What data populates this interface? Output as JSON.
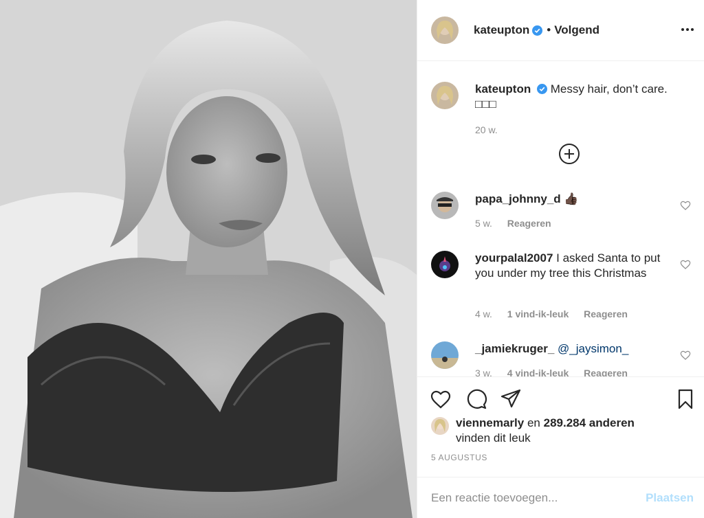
{
  "post": {
    "image_alt": "Black and white portrait photo",
    "author": {
      "username": "kateupton",
      "verified": true,
      "follow_status": "Volgend",
      "separator": "•"
    },
    "caption": {
      "username": "kateupton",
      "text": "Messy hair, don’t care.",
      "emoji_line": "□□□",
      "time": "20 w."
    },
    "comments": [
      {
        "username": "papa_johnny_d",
        "text": "👍🏿",
        "time": "5 w.",
        "likes": "",
        "reply": "Reageren"
      },
      {
        "username": "yourpalal2007",
        "text": "I asked Santa to put you under my tree this Christmas",
        "time": "4 w.",
        "likes": "1 vind-ik-leuk",
        "reply": "Reageren"
      },
      {
        "username": "_jamiekruger_",
        "text": "@_jaysimon_",
        "time": "3 w.",
        "likes": "4 vind-ik-leuk",
        "reply": "Reageren"
      }
    ],
    "liked_by": {
      "username": "viennemarly",
      "conj": "en",
      "count": "289.284 anderen",
      "suffix": "vinden dit leuk"
    },
    "date": "5 AUGUSTUS",
    "add_comment": {
      "placeholder": "Een reactie toevoegen...",
      "post_label": "Plaatsen"
    },
    "icons": {
      "more": "more-horizontal-icon",
      "like": "heart-icon",
      "comment": "comment-bubble-icon",
      "share": "paper-plane-icon",
      "save": "bookmark-icon",
      "load_more": "plus-circle-icon"
    },
    "colors": {
      "verified": "#3897f0",
      "secondary_text": "#8e8e8e",
      "disabled_post": "#b2dffc",
      "mention": "#00376b"
    }
  }
}
